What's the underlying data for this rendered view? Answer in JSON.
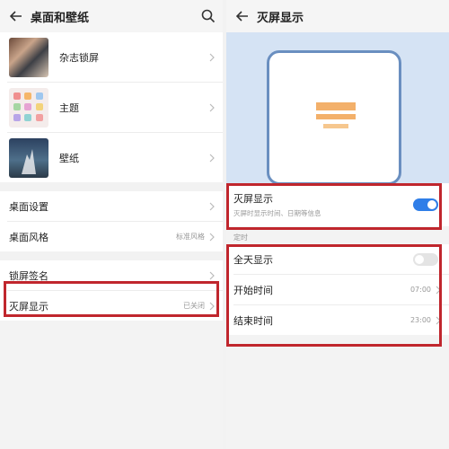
{
  "left": {
    "title": "桌面和壁纸",
    "thumb_items": [
      {
        "label": "杂志锁屏"
      },
      {
        "label": "主题"
      },
      {
        "label": "壁纸"
      }
    ],
    "group2": [
      {
        "label": "桌面设置",
        "value": ""
      },
      {
        "label": "桌面风格",
        "value": "标准风格"
      }
    ],
    "group3": [
      {
        "label": "锁屏签名",
        "value": ""
      },
      {
        "label": "灭屏显示",
        "value": "已关闭"
      }
    ]
  },
  "right": {
    "title": "灭屏显示",
    "aod": {
      "label": "灭屏显示",
      "subtitle": "灭屏时显示时间、日期等信息",
      "enabled": true
    },
    "section_label": "定时",
    "schedule": {
      "all_day_label": "全天显示",
      "all_day_enabled": false,
      "start_label": "开始时间",
      "start_value": "07:00",
      "end_label": "结束时间",
      "end_value": "23:00"
    }
  },
  "colors": {
    "toggle_on": "#2f7ee8",
    "highlight_box": "#c0262d",
    "preview_bg": "#d5e3f4",
    "aod_accent": "#f3b06a"
  }
}
